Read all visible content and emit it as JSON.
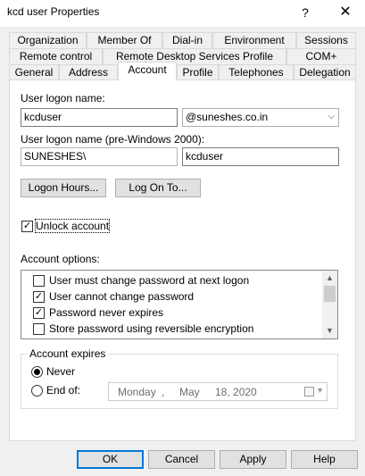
{
  "window": {
    "title": "kcd user Properties",
    "help": "?",
    "close": "✕"
  },
  "tabs": {
    "row1": [
      "Organization",
      "Member Of",
      "Dial-in",
      "Environment",
      "Sessions"
    ],
    "row2": [
      "Remote control",
      "Remote Desktop Services Profile",
      "COM+"
    ],
    "row3": [
      "General",
      "Address",
      "Account",
      "Profile",
      "Telephones",
      "Delegation"
    ],
    "active": "Account"
  },
  "account": {
    "logon_label": "User logon name:",
    "logon_value": "kcduser",
    "domain_value": "@suneshes.co.in",
    "pre2000_label": "User logon name (pre-Windows 2000):",
    "pre2000_domain": "SUNESHES\\",
    "pre2000_value": "kcduser",
    "logon_hours_button": "Logon Hours...",
    "logon_to_button": "Log On To...",
    "unlock_label": "Unlock account",
    "unlock_checked": true,
    "options_label": "Account options:",
    "options": [
      {
        "label": "User must change password at next logon",
        "checked": false
      },
      {
        "label": "User cannot change password",
        "checked": true
      },
      {
        "label": "Password never expires",
        "checked": true
      },
      {
        "label": "Store password using reversible encryption",
        "checked": false
      }
    ],
    "expires_group": "Account expires",
    "never_label": "Never",
    "end_of_label": "End of:",
    "selected_expiry": "never",
    "date": {
      "day_name": "Monday",
      "sep": ",",
      "month": "May",
      "day_year": "18, 2020"
    }
  },
  "footer": {
    "ok": "OK",
    "cancel": "Cancel",
    "apply": "Apply",
    "help": "Help"
  }
}
